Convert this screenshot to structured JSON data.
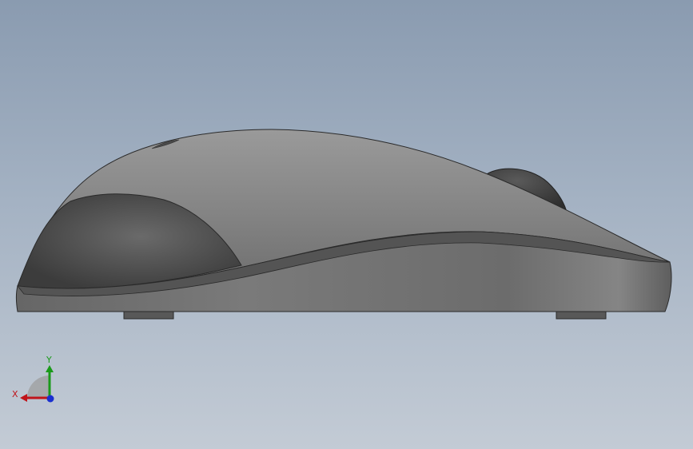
{
  "viewport": {
    "background_top": "#8a9bb0",
    "background_bottom": "#c3cbd5"
  },
  "model": {
    "name": "mouse-side-view",
    "body_color": "#7a7a7a",
    "side_grip_color": "#4f4f4f",
    "wheel_color": "#3f3f3f",
    "foot_color": "#5a5a5a"
  },
  "triad": {
    "x_label": "X",
    "y_label": "Y",
    "x_color": "#c0141a",
    "y_color": "#1a9a1a",
    "z_color": "#1a2fd0"
  }
}
